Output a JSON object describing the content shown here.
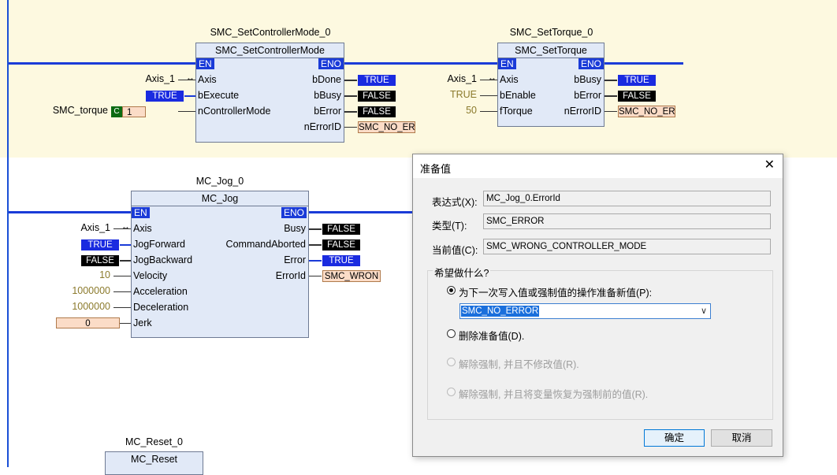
{
  "ladder": {
    "fb1": {
      "instance": "SMC_SetControllerMode_0",
      "type": "SMC_SetControllerMode",
      "en": "EN",
      "eno": "ENO",
      "in_axis": "Axis",
      "in_bexecute": "bExecute",
      "in_mode": "nControllerMode",
      "out_bdone": "bDone",
      "out_bbusy": "bBusy",
      "out_berror": "bError",
      "out_nerror": "nErrorID",
      "var_axis": "Axis_1",
      "val_bexecute": "TRUE",
      "var_torque": "SMC_torque",
      "torque_c": "C",
      "torque_val": "1",
      "val_bdone": "TRUE",
      "val_bbusy": "FALSE",
      "val_berror": "FALSE",
      "val_nerror": "SMC_NO_ER"
    },
    "fb2": {
      "instance": "SMC_SetTorque_0",
      "type": "SMC_SetTorque",
      "en": "EN",
      "eno": "ENO",
      "in_axis": "Axis",
      "in_benable": "bEnable",
      "in_ftorque": "fTorque",
      "out_bbusy": "bBusy",
      "out_berror": "bError",
      "out_nerror": "nErrorID",
      "var_axis": "Axis_1",
      "val_benable": "TRUE",
      "val_ftorque": "50",
      "val_bbusy": "TRUE",
      "val_berror": "FALSE",
      "val_nerror": "SMC_NO_ER"
    },
    "fb3": {
      "instance": "MC_Jog_0",
      "type": "MC_Jog",
      "en": "EN",
      "eno": "ENO",
      "in_axis": "Axis",
      "in_jogf": "JogForward",
      "in_jogb": "JogBackward",
      "in_vel": "Velocity",
      "in_acc": "Acceleration",
      "in_dec": "Deceleration",
      "in_jerk": "Jerk",
      "out_busy": "Busy",
      "out_cmdab": "CommandAborted",
      "out_error": "Error",
      "out_errid": "ErrorId",
      "var_axis": "Axis_1",
      "val_jogf": "TRUE",
      "val_jogb": "FALSE",
      "val_vel": "10",
      "val_acc": "1000000",
      "val_dec": "1000000",
      "val_jerk": "0",
      "val_busy": "FALSE",
      "val_cmdab": "FALSE",
      "val_error": "TRUE",
      "val_errid": "SMC_WRON"
    },
    "fb4": {
      "instance": "MC_Reset_0",
      "type": "MC_Reset"
    }
  },
  "dialog": {
    "title": "准备值",
    "close": "✕",
    "expr_label": "表达式(X):",
    "expr_value": "MC_Jog_0.ErrorId",
    "type_label": "类型(T):",
    "type_value": "SMC_ERROR",
    "cur_label": "当前值(C):",
    "cur_value": "SMC_WRONG_CONTROLLER_MODE",
    "group_title": "希望做什么?",
    "opt1": "为下一次写入值或强制值的操作准备新值(P):",
    "combo_value": "SMC_NO_ERROR",
    "opt2": "删除准备值(D).",
    "opt3": "解除强制, 并且不修改值(R).",
    "opt4": "解除强制, 并且将变量恢复为强制前的值(R).",
    "ok": "确定",
    "cancel": "取消"
  },
  "colors": {
    "rung": "#1a3bd8",
    "true_bg": "#1a2be0",
    "false_bg": "#000000",
    "band": "#fdf9e0",
    "fb_bg": "#e1e9f7"
  }
}
